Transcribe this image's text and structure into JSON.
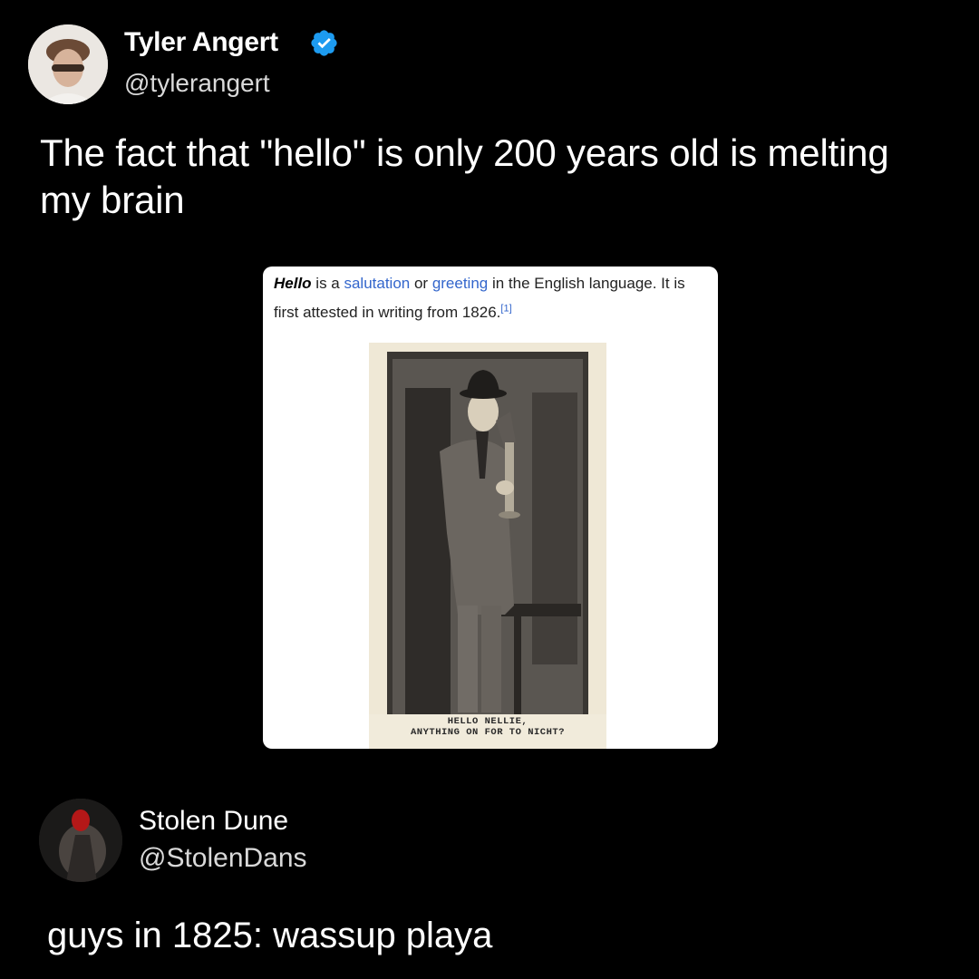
{
  "tweet1": {
    "author_name": "Tyler Angert",
    "author_handle": "@tylerangert",
    "verified": true,
    "text": "The fact that \"hello\" is only 200 years old is melting my brain",
    "embed": {
      "term": "Hello",
      "t1": " is a ",
      "link1": "salutation",
      "t2": " or ",
      "link2": "greeting",
      "t3": " in the English language. It is first attested in writing from 1826.",
      "ref": "[1]",
      "caption_line1": "HELLO  NELLIE,",
      "caption_line2": "ANYTHING ON FOR TO NICHT?"
    }
  },
  "tweet2": {
    "author_name": "Stolen Dune",
    "author_handle": "@StolenDans",
    "text": "guys in 1825: wassup playa"
  },
  "colors": {
    "background": "#000000",
    "verified_badge": "#1d9bf0",
    "wiki_link": "#3366cc"
  }
}
